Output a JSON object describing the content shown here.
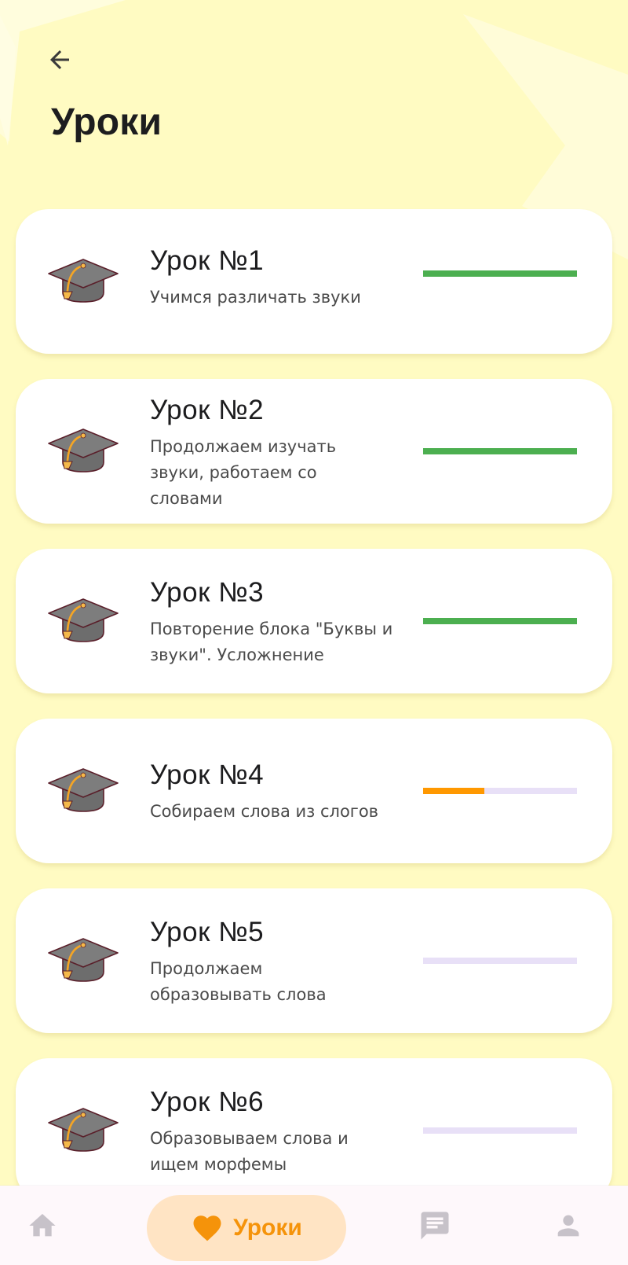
{
  "header": {
    "title": "Уроки"
  },
  "lessons": [
    {
      "title": "Урок №1",
      "description": "Учимся различать звуки",
      "progress": 1.0,
      "color": "#4CAF50"
    },
    {
      "title": "Урок №2",
      "description": "Продолжаем изучать звуки, работаем со словами",
      "progress": 1.0,
      "color": "#4CAF50"
    },
    {
      "title": "Урок №3",
      "description": "Повторение блока \"Буквы и звуки\". Усложнение",
      "progress": 1.0,
      "color": "#4CAF50"
    },
    {
      "title": "Урок №4",
      "description": "Собираем слова из слогов",
      "progress": 0.4,
      "color": "#FF9800"
    },
    {
      "title": "Урок №5",
      "description": "Продолжаем образовывать слова",
      "progress": 0.0,
      "color": "#FF9800"
    },
    {
      "title": "Урок №6",
      "description": "Образовываем слова и ищем морфемы",
      "progress": 0.0,
      "color": "#FF9800"
    }
  ],
  "bottom_nav": {
    "items": [
      {
        "icon": "home-icon",
        "label": ""
      },
      {
        "icon": "heart-icon",
        "label": "Уроки",
        "active": true
      },
      {
        "icon": "chat-icon",
        "label": ""
      },
      {
        "icon": "profile-icon",
        "label": ""
      }
    ]
  },
  "colors": {
    "background": "#FFFBC2",
    "complete": "#4CAF50",
    "in_progress": "#FF9800",
    "track": "#E8E0F7",
    "accent": "#F5930A",
    "nav_active_bg": "#FFE4C4"
  }
}
